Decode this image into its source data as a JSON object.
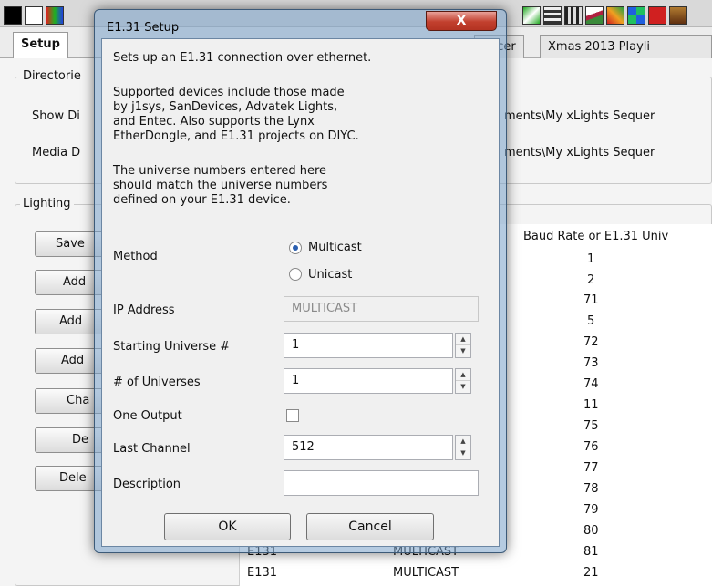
{
  "toolbar": {
    "icons": [
      {
        "name": "black-swatch-icon",
        "color": "#000000"
      },
      {
        "name": "white-swatch-icon",
        "color": "#ffffff"
      },
      {
        "name": "rgb-swatch-icon",
        "color": "#2a7b2a"
      },
      {
        "name": "effect-icon-1",
        "color": "#3c3c3c"
      },
      {
        "name": "effect-icon-2",
        "color": "#7a3a7a"
      },
      {
        "name": "effect-icon-3",
        "color": "#2a7a2a"
      },
      {
        "name": "effect-icon-4",
        "color": "#c02020"
      },
      {
        "name": "effect-icon-5",
        "color": "#c07020"
      },
      {
        "name": "effect-icon-6",
        "color": "#20a040"
      },
      {
        "name": "effect-icon-7",
        "color": "#d02020"
      },
      {
        "name": "effect-icon-8",
        "color": "#a07030"
      }
    ]
  },
  "tabs": [
    {
      "label": "Setup",
      "active": true
    },
    {
      "label": "encer"
    },
    {
      "label": "Xmas 2013 Playli"
    }
  ],
  "directories": {
    "group_label": "Directorie",
    "show_label": "Show Di",
    "show_value": "ments\\My xLights Sequer",
    "media_label": "Media D",
    "media_value": "ments\\My xLights Sequer"
  },
  "lighting": {
    "group_label": "Lighting",
    "buttons": [
      "Save",
      "Add",
      "Add",
      "Add",
      "Cha",
      "De",
      "Dele"
    ]
  },
  "table": {
    "header": "Baud Rate or E1.31 Univ",
    "values": [
      "1",
      "2",
      "71",
      "5",
      "72",
      "73",
      "74",
      "11",
      "75",
      "76",
      "77",
      "78",
      "79",
      "80",
      "81",
      "21"
    ],
    "bottom_rows": [
      {
        "type": "E131",
        "ip": "MULTICAST"
      },
      {
        "type": "E131",
        "ip": "MULTICAST"
      }
    ]
  },
  "dialog": {
    "title": "E1.31 Setup",
    "close_label": "X",
    "intro": "Sets up an E1.31 connection over ethernet.",
    "supported": [
      "Supported devices include those made",
      "by j1sys, SanDevices, Advatek Lights,",
      "and Entec. Also supports the Lynx",
      "EtherDongle, and E1.31 projects on DIYC."
    ],
    "universe_note": [
      "The universe numbers entered here",
      "should match the universe numbers",
      "defined on your E1.31 device."
    ],
    "method_label": "Method",
    "method_options": [
      {
        "label": "Multicast",
        "selected": true
      },
      {
        "label": "Unicast",
        "selected": false
      }
    ],
    "ip_label": "IP Address",
    "ip_value": "MULTICAST",
    "start_universe_label": "Starting Universe #",
    "start_universe_value": "1",
    "num_universes_label": "# of Universes",
    "num_universes_value": "1",
    "one_output_label": "One Output",
    "one_output_checked": false,
    "last_channel_label": "Last Channel",
    "last_channel_value": "512",
    "description_label": "Description",
    "description_value": "",
    "ok_label": "OK",
    "cancel_label": "Cancel"
  }
}
